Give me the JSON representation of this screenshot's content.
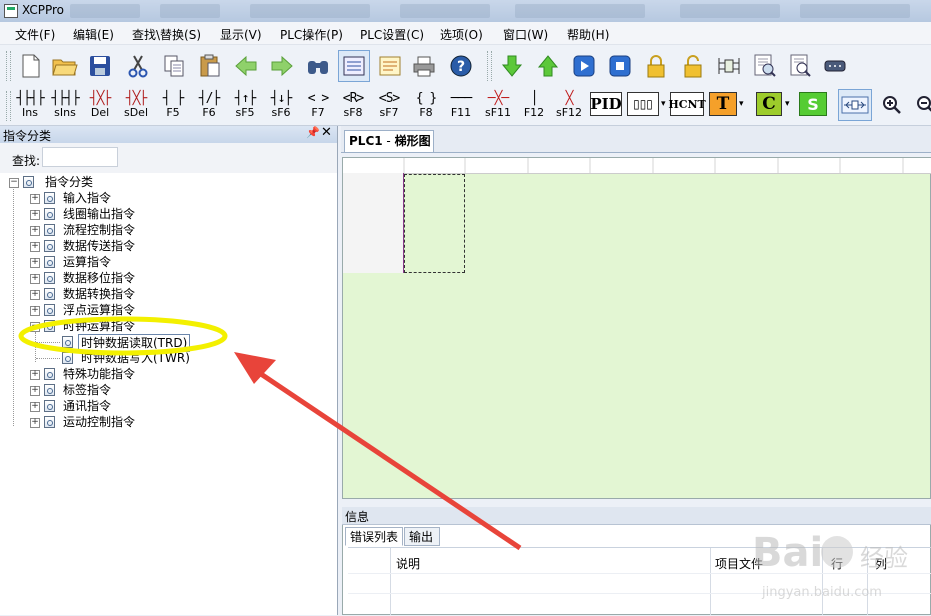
{
  "window": {
    "title": "XCPPro"
  },
  "menu": [
    "文件(F)",
    "编辑(E)",
    "查找\\替换(S)",
    "显示(V)",
    "PLC操作(P)",
    "PLC设置(C)",
    "选项(O)",
    "窗口(W)",
    "帮助(H)"
  ],
  "toolbar1": {
    "icons": [
      "new-file-icon",
      "open-folder-icon",
      "save-icon",
      "cut-icon",
      "copy-icon",
      "paste-icon",
      "back-arrow-icon",
      "forward-arrow-icon",
      "find-binoculars-icon",
      "ladder-view-icon",
      "list-view-icon",
      "print-icon",
      "help-icon",
      "download-icon",
      "upload-icon",
      "run-icon",
      "stop-icon",
      "lock-icon",
      "unlock-icon",
      "monitor-icon",
      "search-doc-icon",
      "search-replace-icon",
      "serial-port-icon"
    ]
  },
  "toolbar2": {
    "ladder_buttons": [
      {
        "sym": "┤├┤├",
        "label": "Ins"
      },
      {
        "sym": "┤├┤├",
        "label": "sIns"
      },
      {
        "sym": "┤╳├",
        "label": "Del"
      },
      {
        "sym": "┤╳├",
        "label": "sDel"
      },
      {
        "sym": "┤ ├",
        "label": "F5"
      },
      {
        "sym": "┤/├",
        "label": "F6"
      },
      {
        "sym": "┤↑├",
        "label": "sF5"
      },
      {
        "sym": "┤↓├",
        "label": "sF6"
      },
      {
        "sym": "< >",
        "label": "F7"
      },
      {
        "sym": "<R>",
        "label": "sF8"
      },
      {
        "sym": "<S>",
        "label": "sF7"
      },
      {
        "sym": "{ }",
        "label": "F8"
      },
      {
        "sym": "───",
        "label": "F11"
      },
      {
        "sym": "─╳─",
        "label": "sF11"
      },
      {
        "sym": "│",
        "label": "F12"
      },
      {
        "sym": "╳",
        "label": "sF12"
      }
    ],
    "box_buttons": [
      {
        "text": "PID",
        "color": "#ffffff"
      },
      {
        "text": "▯▯▯",
        "color": "#ffffff"
      },
      {
        "text": "HCNT",
        "color": "#ffffff"
      },
      {
        "text": "T",
        "color": "#f5a02a"
      },
      {
        "text": "C",
        "color": "#9dcc2b"
      },
      {
        "text": "S",
        "color": "#55cc33"
      }
    ],
    "extra_icons": [
      "wire-toggle-icon",
      "zoom-in-icon",
      "zoom-out-icon"
    ]
  },
  "left_panel": {
    "title": "指令分类",
    "search_label": "查找:",
    "search_value": "",
    "tree": {
      "root": "指令分类",
      "items": [
        "输入指令",
        "线圈输出指令",
        "流程控制指令",
        "数据传送指令",
        "运算指令",
        "数据移位指令",
        "数据转换指令",
        "浮点运算指令",
        "时钟运算指令"
      ],
      "children": [
        "时钟数据读取(TRD)",
        "时钟数据写入(TWR)"
      ],
      "items_after": [
        "特殊功能指令",
        "标签指令",
        "通讯指令",
        "运动控制指令"
      ]
    }
  },
  "editor": {
    "tab_plc": "PLC1",
    "tab_sep": " - ",
    "tab_name": "梯形图"
  },
  "info_panel": {
    "title": "信息",
    "tabs": [
      "错误列表",
      "输出"
    ],
    "columns": [
      "说明",
      "项目文件",
      "行",
      "列"
    ]
  },
  "colors": {
    "annotation": "#f3f000",
    "arrow": "#e8443a",
    "ladder_bg": "#e3f6d3"
  }
}
